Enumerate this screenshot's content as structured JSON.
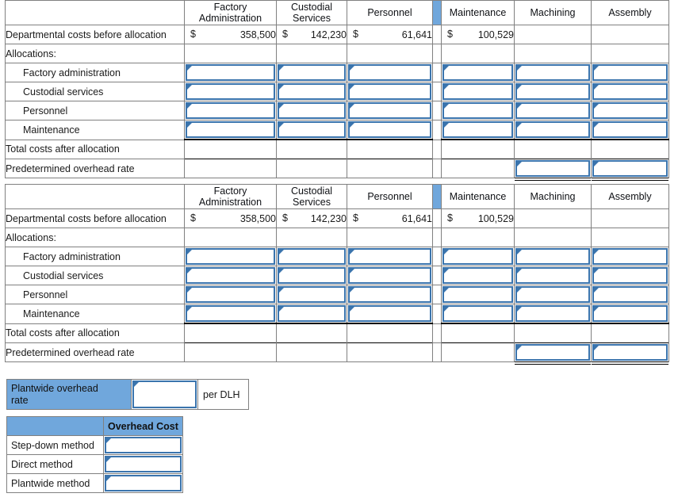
{
  "allocation_tables": [
    {
      "id": "step-down-allocation-table",
      "columns": [
        {
          "label": "",
          "key": "label"
        },
        {
          "label": "Factory Administration",
          "key": "factory_admin"
        },
        {
          "label": "Custodial Services",
          "key": "custodial"
        },
        {
          "label": "Personnel",
          "key": "personnel"
        },
        {
          "label": "Maintenance",
          "key": "maintenance"
        },
        {
          "label": "Machining",
          "key": "machining"
        },
        {
          "label": "Assembly",
          "key": "assembly"
        }
      ],
      "rows": [
        {
          "label": "Departmental costs before allocation",
          "type": "values",
          "currency": "$",
          "values": [
            "358,500",
            "142,230",
            "61,641",
            "100,529",
            "",
            ""
          ]
        },
        {
          "label": "Allocations:",
          "type": "section",
          "values": [
            "",
            "",
            "",
            "",
            "",
            ""
          ]
        },
        {
          "label": "Factory administration",
          "type": "inputs",
          "indent": true
        },
        {
          "label": "Custodial services",
          "type": "inputs",
          "indent": true
        },
        {
          "label": "Personnel",
          "type": "inputs",
          "indent": true
        },
        {
          "label": "Maintenance",
          "type": "inputs",
          "indent": true
        },
        {
          "label": "Total costs after allocation",
          "type": "total"
        },
        {
          "label": "Predetermined overhead rate",
          "type": "rate"
        }
      ]
    },
    {
      "id": "direct-method-allocation-table",
      "columns": [
        {
          "label": "",
          "key": "label"
        },
        {
          "label": "Factory Administration",
          "key": "factory_admin"
        },
        {
          "label": "Custodial Services",
          "key": "custodial"
        },
        {
          "label": "Personnel",
          "key": "personnel"
        },
        {
          "label": "Maintenance",
          "key": "maintenance"
        },
        {
          "label": "Machining",
          "key": "machining"
        },
        {
          "label": "Assembly",
          "key": "assembly"
        }
      ],
      "rows": [
        {
          "label": "Departmental costs before allocation",
          "type": "values",
          "currency": "$",
          "values": [
            "358,500",
            "142,230",
            "61,641",
            "100,529",
            "",
            ""
          ]
        },
        {
          "label": "Allocations:",
          "type": "section",
          "values": [
            "",
            "",
            "",
            "",
            "",
            ""
          ]
        },
        {
          "label": "Factory administration",
          "type": "inputs",
          "indent": true
        },
        {
          "label": "Custodial services",
          "type": "inputs",
          "indent": true
        },
        {
          "label": "Personnel",
          "type": "inputs",
          "indent": true
        },
        {
          "label": "Maintenance",
          "type": "inputs",
          "indent": true
        },
        {
          "label": "Total costs after allocation",
          "type": "total"
        },
        {
          "label": "Predetermined overhead rate",
          "type": "rate"
        }
      ]
    }
  ],
  "table_headers": {
    "t0_c1_line1": "Factory",
    "t0_c1_line2": "Administration",
    "t0_c2_line1": "Custodial",
    "t0_c2_line2": "Services",
    "t0_c3": "Personnel",
    "t0_c4": "Maintenance",
    "t0_c5": "Machining",
    "t0_c6": "Assembly"
  },
  "plantwide": {
    "label_line1": "Plantwide overhead",
    "label_line2": "rate",
    "value": "",
    "value_placeholder": "",
    "unit": "per DLH"
  },
  "methods_table": {
    "corner_label": "",
    "column_header": "Overhead Cost",
    "rows": [
      {
        "label": "Step-down method",
        "value": "",
        "placeholder": ""
      },
      {
        "label": "Direct method",
        "value": "",
        "placeholder": ""
      },
      {
        "label": "Plantwide method",
        "value": "",
        "placeholder": ""
      }
    ]
  },
  "colors": {
    "header_blue": "#70a7dc",
    "input_border_blue": "#3a74ad",
    "grid_gray": "#808080",
    "rule_black": "#000000"
  }
}
